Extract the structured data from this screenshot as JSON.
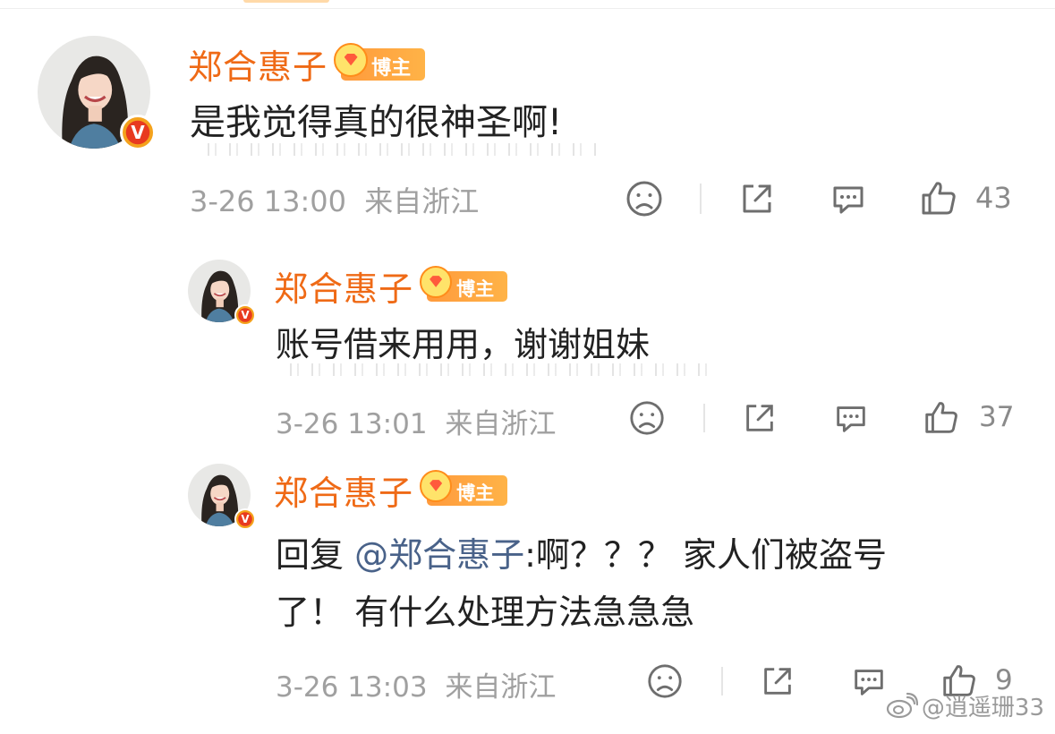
{
  "comments": [
    {
      "user": "郑合惠子",
      "badge": "博主",
      "text": "是我觉得真的很神圣啊!",
      "time": "3-26 13:00",
      "location": "来自浙江",
      "likes": "43"
    },
    {
      "user": "郑合惠子",
      "badge": "博主",
      "text": "账号借来用用，谢谢姐妹",
      "time": "3-26 13:01",
      "location": "来自浙江",
      "likes": "37"
    },
    {
      "user": "郑合惠子",
      "badge": "博主",
      "reply_prefix": "回复 ",
      "mention": "@郑合惠子",
      "text_line1": ":啊？？？ 家人们被盗号",
      "text_line2": "了！ 有什么处理方法急急急",
      "time": "3-26 13:03",
      "location": "来自浙江",
      "likes": "9"
    }
  ],
  "verified_badge": "V",
  "watermark": "@逍遥珊33",
  "icons": {
    "dislike": "sad-face-icon",
    "share": "share-icon",
    "reply": "comment-icon",
    "like": "thumbs-up-icon"
  },
  "colors": {
    "username": "#ef6a16",
    "mention": "#496289",
    "meta": "#a0a0a0"
  }
}
